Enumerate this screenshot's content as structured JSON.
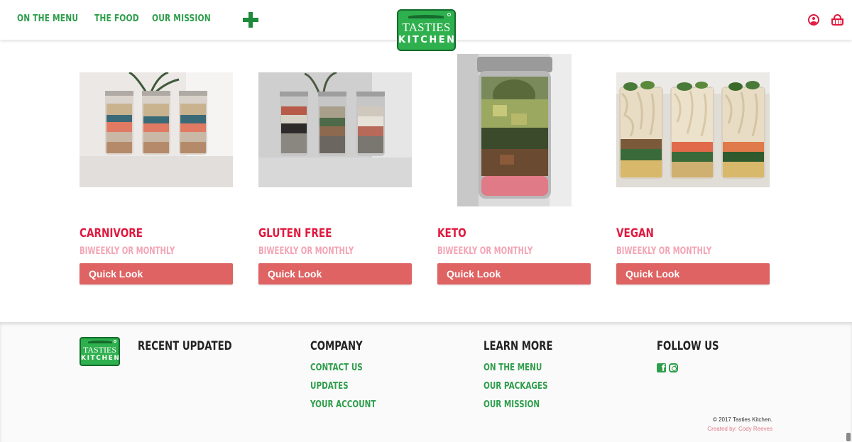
{
  "header": {
    "nav": [
      "ON THE MENU",
      "THE FOOD",
      "OUR MISSION"
    ],
    "logo_line1": "TASTIES",
    "logo_line2": "KITCHEN",
    "icons": [
      "plus-icon",
      "user-icon",
      "basket-icon"
    ],
    "accent_color": "#2e9e4b",
    "icon_color": "#e0193f"
  },
  "products": [
    {
      "name": "CARNIVORE",
      "subtitle": "BIWEEKLY OR MONTHLY",
      "button": "Quick Look"
    },
    {
      "name": "GLUTEN FREE",
      "subtitle": "BIWEEKLY OR MONTHLY",
      "button": "Quick Look"
    },
    {
      "name": "KETO",
      "subtitle": "BIWEEKLY OR MONTHLY",
      "button": "Quick Look"
    },
    {
      "name": "VEGAN",
      "subtitle": "BIWEEKLY OR MONTHLY",
      "button": "Quick Look"
    }
  ],
  "footer": {
    "logo_line1": "TASTIES",
    "logo_line2": "KITCHEN",
    "recent": "RECENT UPDATED",
    "company": {
      "heading": "COMPANY",
      "links": [
        "CONTACT US",
        "UPDATES",
        "YOUR ACCOUNT"
      ]
    },
    "learn": {
      "heading": "LEARN MORE",
      "links": [
        "ON THE MENU",
        "OUR PACKAGES",
        "OUR MISSION"
      ]
    },
    "follow": {
      "heading": "FOLLOW US",
      "icons": [
        "facebook-icon",
        "instagram-icon"
      ]
    },
    "copyright": "© 2017 Tasties Kitchen.",
    "credit": "Created by: Cody Reeves"
  },
  "colors": {
    "product_name": "#e0193f",
    "product_subtitle": "#f3a5b5",
    "button_bg": "#de6362"
  }
}
